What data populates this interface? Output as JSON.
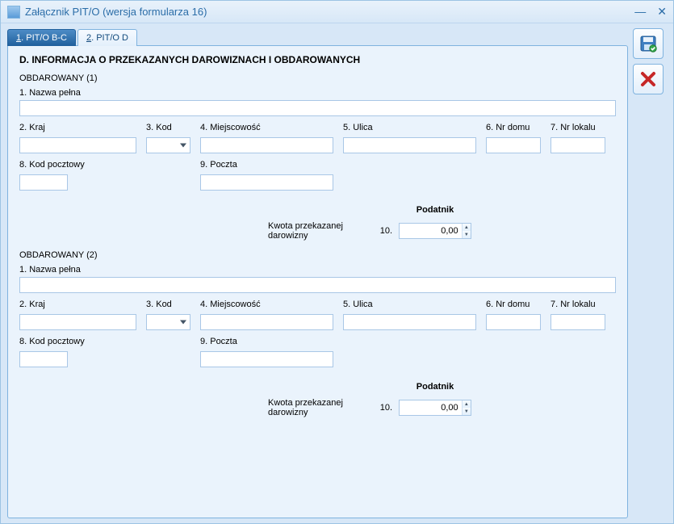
{
  "window": {
    "title": "Załącznik PIT/O (wersja formularza 16)"
  },
  "tabs": [
    {
      "label_prefix": "1",
      "label_rest": " . PIT/O B-C",
      "active": true
    },
    {
      "label_prefix": "2",
      "label_rest": " . PIT/O D",
      "active": false
    }
  ],
  "section_title": "D. INFORMACJA O PRZEKAZANYCH DAROWIZNACH I OBDAROWANYCH",
  "field_labels": {
    "nazwa": "1. Nazwa pełna",
    "kraj": "2. Kraj",
    "kod": "3. Kod",
    "miejscowosc": "4. Miejscowość",
    "ulica": "5. Ulica",
    "nrdomu": "6. Nr domu",
    "nrlokalu": "7. Nr lokalu",
    "kodpoczt": "8. Kod pocztowy",
    "poczta": "9. Poczta",
    "podatnik": "Podatnik",
    "kwota": "Kwota przekazanej darowizny",
    "num10": "10."
  },
  "recipients": [
    {
      "heading": "OBDAROWANY (1)",
      "nazwa": "",
      "kraj": "",
      "kod": "",
      "miejscowosc": "",
      "ulica": "",
      "nrdomu": "",
      "nrlokalu": "",
      "kodpoczt": "",
      "poczta": "",
      "kwota": "0,00"
    },
    {
      "heading": "OBDAROWANY (2)",
      "nazwa": "",
      "kraj": "",
      "kod": "",
      "miejscowosc": "",
      "ulica": "",
      "nrdomu": "",
      "nrlokalu": "",
      "kodpoczt": "",
      "poczta": "",
      "kwota": "0,00"
    }
  ]
}
